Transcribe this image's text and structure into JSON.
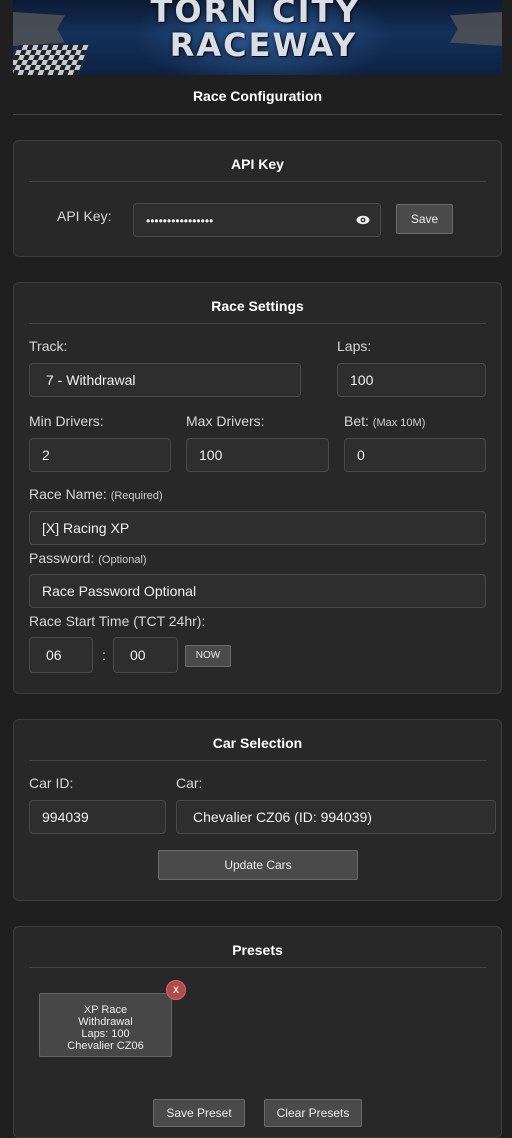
{
  "banner": {
    "line1": "TORN CITY",
    "line2": "RACEWAY"
  },
  "page_title": "Race Configuration",
  "api_section": {
    "title": "API Key",
    "label": "API Key:",
    "value": "••••••••••••••••",
    "save_label": "Save"
  },
  "race_settings": {
    "title": "Race Settings",
    "track_label": "Track:",
    "track_value": "7 - Withdrawal",
    "laps_label": "Laps:",
    "laps_value": "100",
    "min_drivers_label": "Min Drivers:",
    "min_drivers_value": "2",
    "max_drivers_label": "Max Drivers:",
    "max_drivers_value": "100",
    "bet_label": "Bet:",
    "bet_note": "(Max 10M)",
    "bet_value": "0",
    "race_name_label": "Race Name:",
    "race_name_note": "(Required)",
    "race_name_value": "[X] Racing XP",
    "password_label": "Password:",
    "password_note": "(Optional)",
    "password_placeholder": "Race Password Optional",
    "start_time_label": "Race Start Time (TCT 24hr):",
    "hour_value": "06",
    "separator": ":",
    "minute_value": "00",
    "now_label": "NOW"
  },
  "car_selection": {
    "title": "Car Selection",
    "car_id_label": "Car ID:",
    "car_id_value": "994039",
    "car_label": "Car:",
    "car_value": "Chevalier CZ06 (ID: 994039)",
    "update_label": "Update Cars"
  },
  "presets": {
    "title": "Presets",
    "cards": [
      {
        "line1": "XP Race",
        "line2": "Withdrawal",
        "line3": "Laps: 100",
        "line4": "Chevalier CZ06",
        "remove": "x"
      }
    ],
    "save_label": "Save Preset",
    "clear_label": "Clear Presets"
  },
  "colors": {
    "background": "#1f1f1f",
    "panel": "#282828",
    "remove_badge": "#b24a4a"
  }
}
